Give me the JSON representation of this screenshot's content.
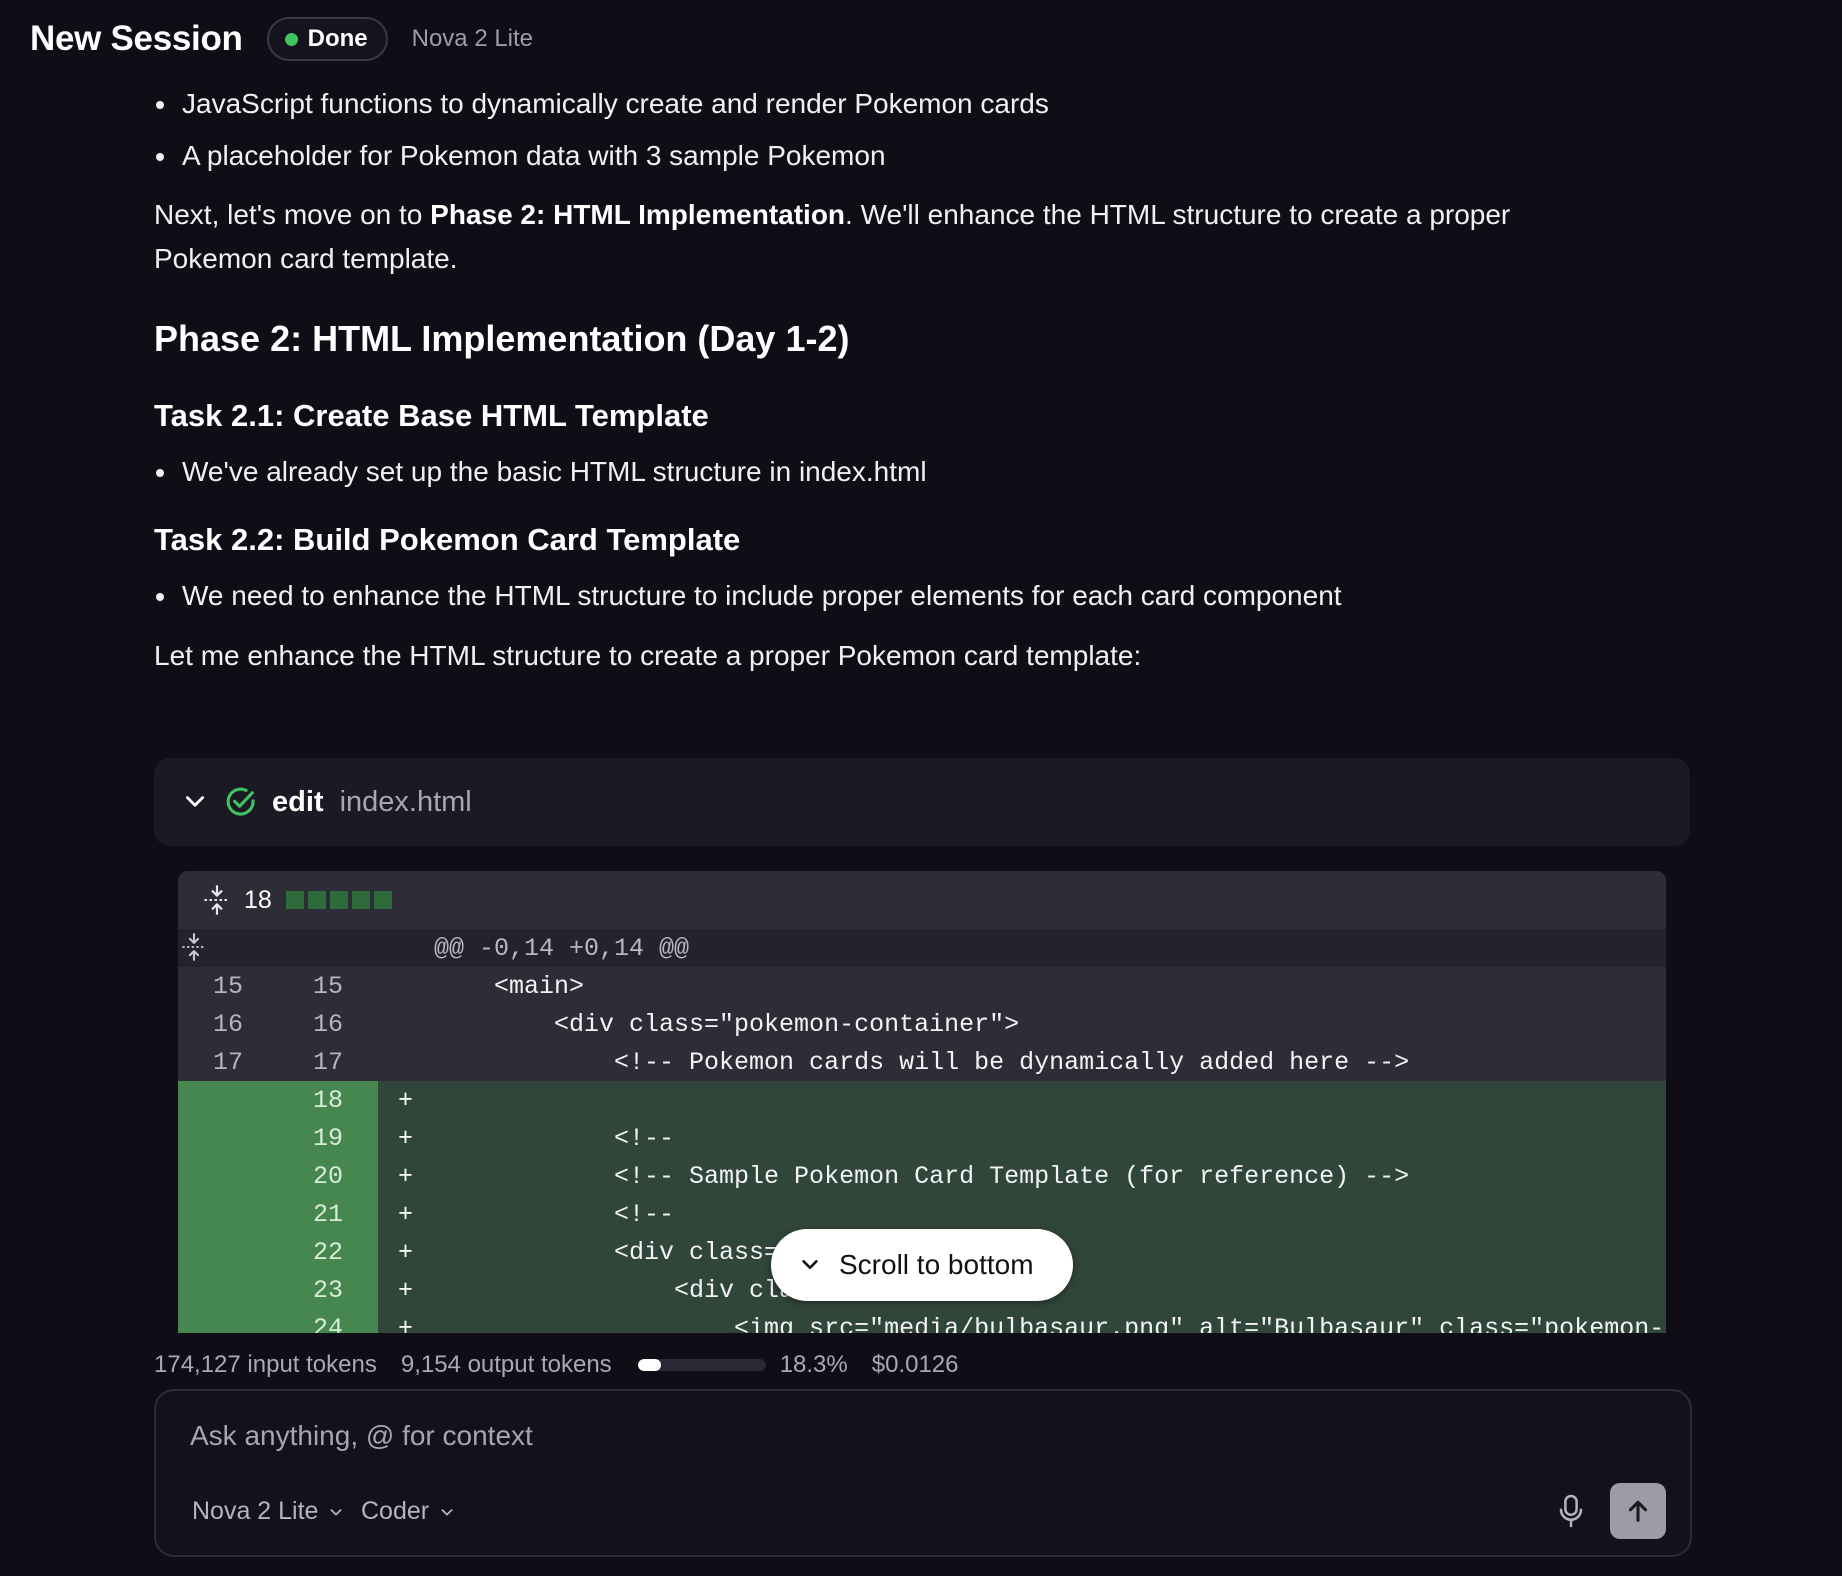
{
  "header": {
    "title": "New Session",
    "status": "Done",
    "model": "Nova 2 Lite"
  },
  "message": {
    "bullets_top": [
      "JavaScript functions to dynamically create and render Pokemon cards",
      "A placeholder for Pokemon data with 3 sample Pokemon"
    ],
    "next_prefix": "Next, let's move on to ",
    "next_bold": "Phase 2: HTML Implementation",
    "next_suffix": ". We'll enhance the HTML structure to create a proper",
    "next_line2": "Pokemon card template.",
    "phase_heading": "Phase 2: HTML Implementation (Day 1-2)",
    "task21_heading": "Task 2.1: Create Base HTML Template",
    "task21_bullet": "We've already set up the basic HTML structure in index.html",
    "task22_heading": "Task 2.2: Build Pokemon Card Template",
    "task22_bullet": "We need to enhance the HTML structure to include proper elements for each card component",
    "closing": "Let me enhance the HTML structure to create a proper Pokemon card template:"
  },
  "tool_call": {
    "action": "edit",
    "file": "index.html"
  },
  "diff": {
    "changed_count": "18",
    "hunk_header": "@@ -0,14 +0,14 @@",
    "lines": [
      {
        "type": "ctx",
        "old": "15",
        "new": "15",
        "sign": "",
        "code": "    <main>"
      },
      {
        "type": "ctx",
        "old": "16",
        "new": "16",
        "sign": "",
        "code": "        <div class=\"pokemon-container\">"
      },
      {
        "type": "ctx",
        "old": "17",
        "new": "17",
        "sign": "",
        "code": "            <!-- Pokemon cards will be dynamically added here -->"
      },
      {
        "type": "add",
        "old": "",
        "new": "18",
        "sign": "+",
        "code": ""
      },
      {
        "type": "add",
        "old": "",
        "new": "19",
        "sign": "+",
        "code": "            <!--"
      },
      {
        "type": "add",
        "old": "",
        "new": "20",
        "sign": "+",
        "code": "            <!-- Sample Pokemon Card Template (for reference) -->"
      },
      {
        "type": "add",
        "old": "",
        "new": "21",
        "sign": "+",
        "code": "            <!--"
      },
      {
        "type": "add",
        "old": "",
        "new": "22",
        "sign": "+",
        "code": "            <div class=\""
      },
      {
        "type": "add",
        "old": "",
        "new": "23",
        "sign": "+",
        "code": "                <div cla"
      },
      {
        "type": "add",
        "old": "",
        "new": "24",
        "sign": "+",
        "code": "                    <img src=\"media/bulbasaur.png\" alt=\"Bulbasaur\" class=\"pokemon-thumbnail\">"
      }
    ]
  },
  "scroll_button": "Scroll to bottom",
  "usage": {
    "input_tokens": "174,127 input tokens",
    "output_tokens": "9,154 output tokens",
    "percent_label": "18.3%",
    "percent_value": 18.3,
    "cost": "$0.0126"
  },
  "composer": {
    "placeholder": "Ask anything, @ for context",
    "model_select": "Nova 2 Lite",
    "mode_select": "Coder"
  }
}
